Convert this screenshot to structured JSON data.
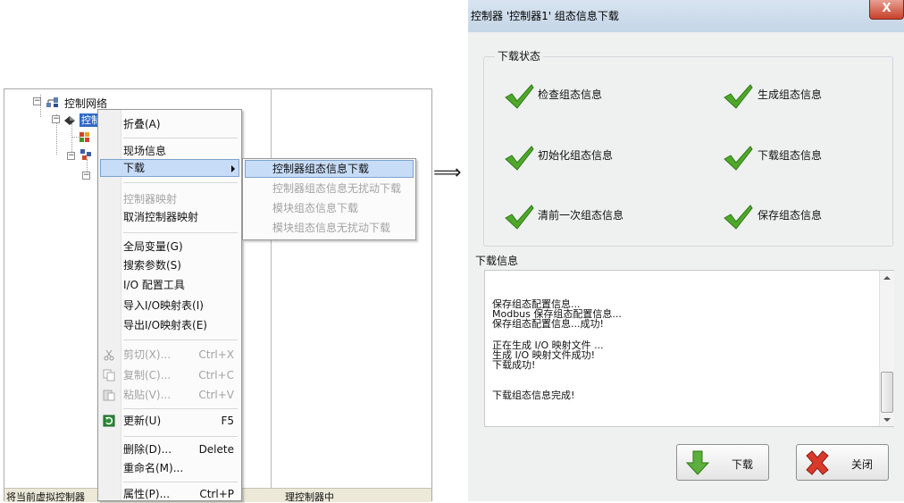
{
  "tree": {
    "root_label": "控制网络",
    "selected_label": "控制"
  },
  "context_menu": {
    "items": {
      "collapse": "折叠(A)",
      "site_info": "现场信息",
      "download": "下载",
      "ctrl_map": "控制器映射",
      "cancel_ctrl_map": "取消控制器映射",
      "global_var": "全局变量(G)",
      "search_param": "搜索参数(S)",
      "io_tool": "I/O 配置工具",
      "import_io": "导入I/O映射表(I)",
      "export_io": "导出I/O映射表(E)",
      "cut": "剪切(X)...",
      "cut_sc": "Ctrl+X",
      "copy": "复制(C)...",
      "copy_sc": "Ctrl+C",
      "paste": "粘贴(V)...",
      "paste_sc": "Ctrl+V",
      "refresh": "更新(U)",
      "refresh_sc": "F5",
      "delete": "删除(D)...",
      "delete_sc": "Delete",
      "rename": "重命名(M)...",
      "props": "属性(P)...",
      "props_sc": "Ctrl+P"
    }
  },
  "submenu": {
    "items": [
      "控制器组态信息下载",
      "控制器组态信息无扰动下载",
      "模块组态信息下载",
      "模块组态信息无扰动下载"
    ]
  },
  "status_bar": {
    "left": "将当前虚拟控制器",
    "right": "理控制器中"
  },
  "flow_arrow": "⟹",
  "dialog": {
    "title": "控制器 '控制器1' 组态信息下载",
    "close_glyph": "X",
    "state_group_label": "下载状态",
    "steps": [
      "检查组态信息",
      "生成组态信息",
      "初始化组态信息",
      "下载组态信息",
      "清前一次组态信息",
      "保存组态信息"
    ],
    "info_label": "下载信息",
    "log_lines": [
      "保存组态配置信息...",
      "Modbus 保存组态配置信息...",
      "保存组态配置信息...成功!",
      "正在生成 I/O 映射文件 ...",
      "生成 I/O 映射文件成功!",
      "下载成功!",
      "下载组态信息完成!"
    ],
    "download_button": "下载",
    "close_button": "关闭"
  },
  "colors": {
    "check_green": "#4fa82a",
    "selection": "#3169c6",
    "menu_highlight": "#c7dcf7"
  }
}
